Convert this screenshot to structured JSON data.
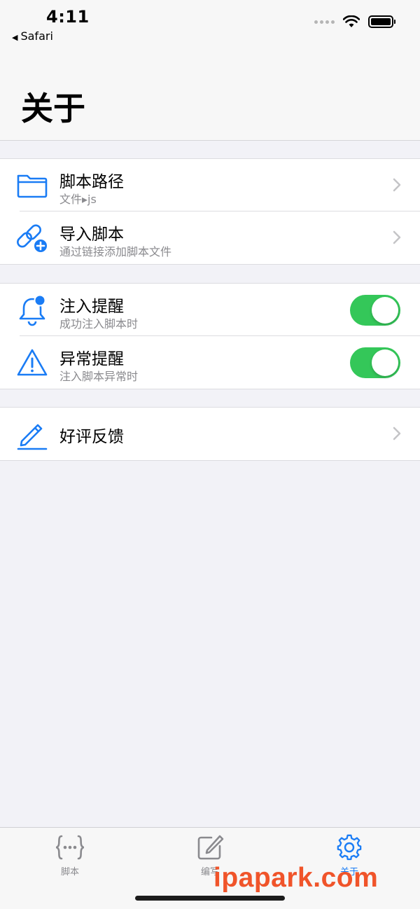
{
  "status_bar": {
    "time": "4:11",
    "back_app": "Safari",
    "icons": [
      "signal-dots-icon",
      "wifi-icon",
      "battery-icon"
    ]
  },
  "header": {
    "title": "关于"
  },
  "groups": [
    {
      "rows": [
        {
          "title": "脚本路径",
          "subtitle": "文件▸js",
          "icon": "folder-icon",
          "accessory": "chevron"
        },
        {
          "title": "导入脚本",
          "subtitle": "通过链接添加脚本文件",
          "icon": "link-add-icon",
          "accessory": "chevron"
        }
      ]
    },
    {
      "rows": [
        {
          "title": "注入提醒",
          "subtitle": "成功注入脚本时",
          "icon": "bell-badge-icon",
          "accessory": "toggle",
          "on": true
        },
        {
          "title": "异常提醒",
          "subtitle": "注入脚本异常时",
          "icon": "warning-triangle-icon",
          "accessory": "toggle",
          "on": true
        }
      ]
    },
    {
      "rows": [
        {
          "title": "好评反馈",
          "icon": "pencil-icon",
          "accessory": "chevron"
        }
      ]
    }
  ],
  "tabbar": {
    "tabs": [
      {
        "label": "脚本",
        "icon": "braces-icon",
        "active": false
      },
      {
        "label": "编写",
        "icon": "compose-icon",
        "active": false
      },
      {
        "label": "关于",
        "icon": "gear-icon",
        "active": true
      }
    ]
  },
  "watermark": "ipapark.com",
  "colors": {
    "accent": "#1a7cf5",
    "toggle_on": "#34c759",
    "background": "#f2f2f7",
    "watermark": "#f0542a"
  }
}
